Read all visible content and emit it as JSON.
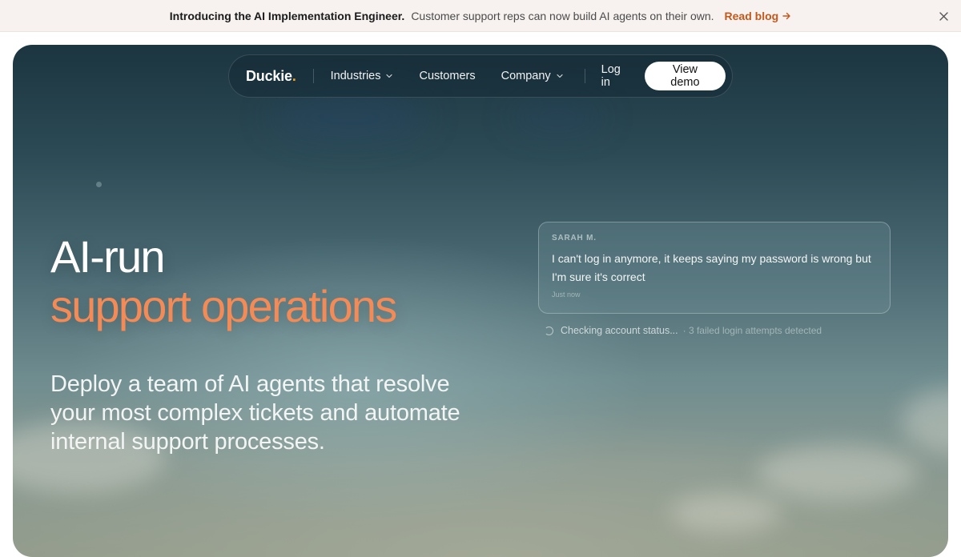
{
  "announcement": {
    "title": "Introducing the AI Implementation Engineer.",
    "description": "Customer support reps can now build AI agents on their own.",
    "link_label": "Read blog",
    "link_icon": "arrow-right-icon",
    "close_icon": "close-icon",
    "accent_color": "#c2581b"
  },
  "nav": {
    "logo_text": "Duckie",
    "logo_dot": ".",
    "items": [
      {
        "label": "Industries",
        "has_dropdown": true
      },
      {
        "label": "Customers",
        "has_dropdown": false
      },
      {
        "label": "Company",
        "has_dropdown": true
      }
    ],
    "login_label": "Log in",
    "demo_label": "View demo"
  },
  "hero": {
    "headline_line1": "AI-run",
    "headline_line2": "support operations",
    "headline_accent_color": "#f48a55",
    "subheadline": "Deploy a team of AI agents that resolve your most complex tickets and automate internal support processes."
  },
  "chat": {
    "sender": "SARAH M.",
    "message": "I can't log in anymore, it keeps saying my password is wrong but I'm sure it's correct",
    "time": "Just now",
    "status_text": "Checking account status...",
    "status_detail": "· 3 failed login attempts detected"
  }
}
